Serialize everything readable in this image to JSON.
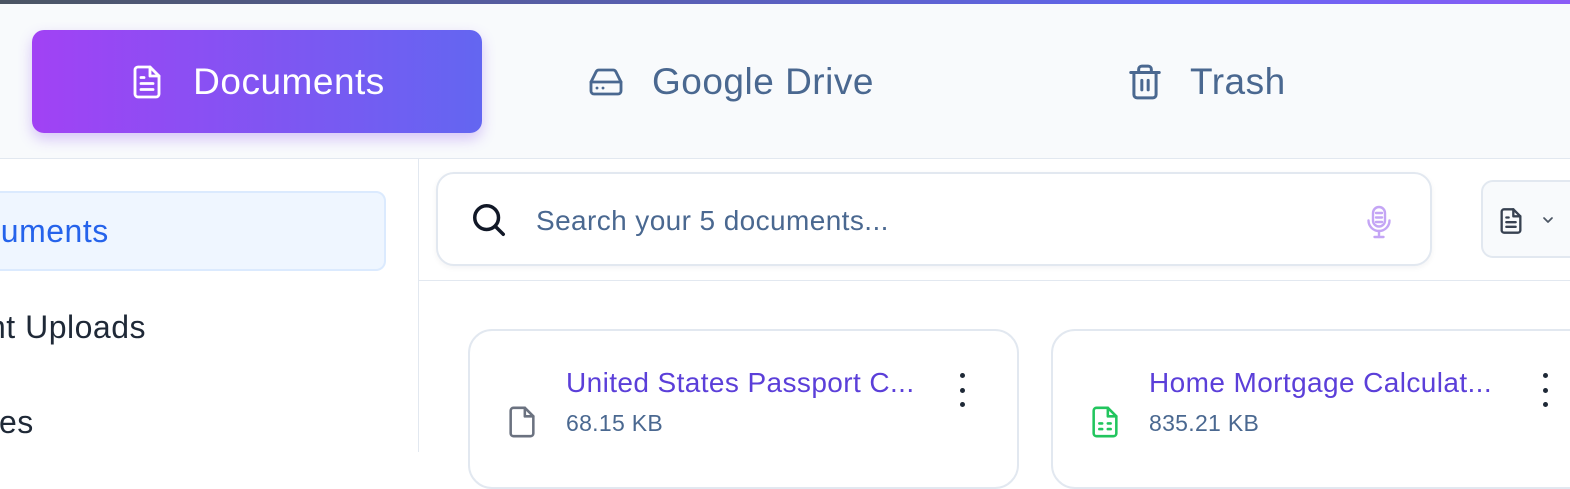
{
  "tabs": [
    {
      "label": "Documents",
      "icon": "file-text-icon",
      "active": true
    },
    {
      "label": "Google Drive",
      "icon": "hard-drive-icon",
      "active": false
    },
    {
      "label": "Trash",
      "icon": "trash-icon",
      "active": false
    }
  ],
  "sidebar": {
    "items": [
      {
        "label": "ocuments",
        "active": true
      },
      {
        "label": "nt Uploads",
        "active": false
      },
      {
        "label": "ites",
        "active": false
      }
    ]
  },
  "search": {
    "placeholder": "Search your 5 documents...",
    "value": "",
    "search_icon": "search-icon",
    "voice_icon": "microphone-icon"
  },
  "filter": {
    "icon": "file-text-icon",
    "chevron": "chevron-down-icon"
  },
  "files": [
    {
      "name": "United States Passport C...",
      "size": "68.15 KB",
      "icon": "file-icon",
      "icon_color": "#6b7280"
    },
    {
      "name": "Home Mortgage Calculat...",
      "size": "835.21 KB",
      "icon": "spreadsheet-icon",
      "icon_color": "#22c55e"
    }
  ],
  "colors": {
    "accent_start": "#a142f4",
    "accent_end": "#6366f1",
    "link": "#5b3fd9",
    "muted": "#4a6890",
    "active_sidebar": "#2563eb"
  }
}
